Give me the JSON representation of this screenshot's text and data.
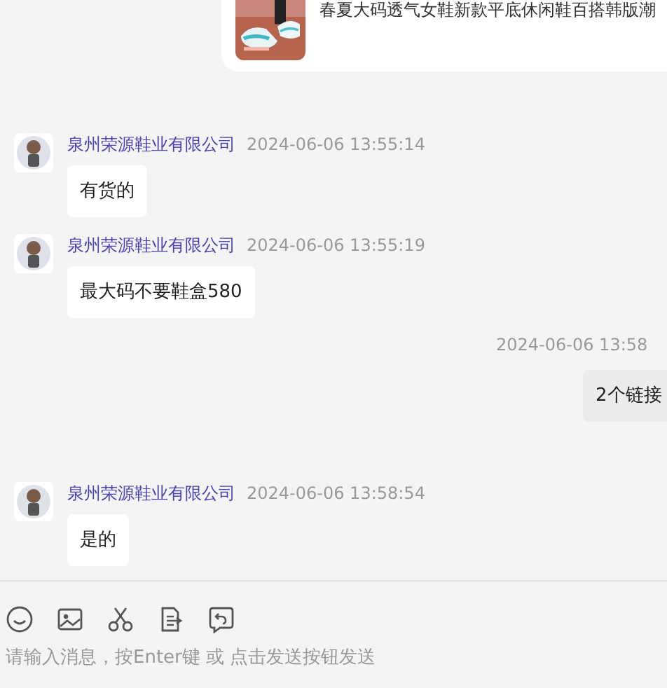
{
  "product_card": {
    "title": "春夏大码透气女鞋新款平底休闲鞋百搭韩版潮"
  },
  "messages": [
    {
      "kind": "incoming",
      "sender": "泉州荣源鞋业有限公司",
      "time": "2024-06-06 13:55:14",
      "text": "有货的"
    },
    {
      "kind": "incoming",
      "sender": "泉州荣源鞋业有限公司",
      "time": "2024-06-06 13:55:19",
      "text": "最大码不要鞋盒580"
    },
    {
      "kind": "outgoing",
      "time": "2024-06-06 13:58",
      "text": "2个链接"
    },
    {
      "kind": "incoming",
      "sender": "泉州荣源鞋业有限公司",
      "time": "2024-06-06 13:58:54",
      "text": "是的"
    }
  ],
  "composer": {
    "placeholder": "请输入消息，按Enter键 或 点击发送按钮发送"
  }
}
